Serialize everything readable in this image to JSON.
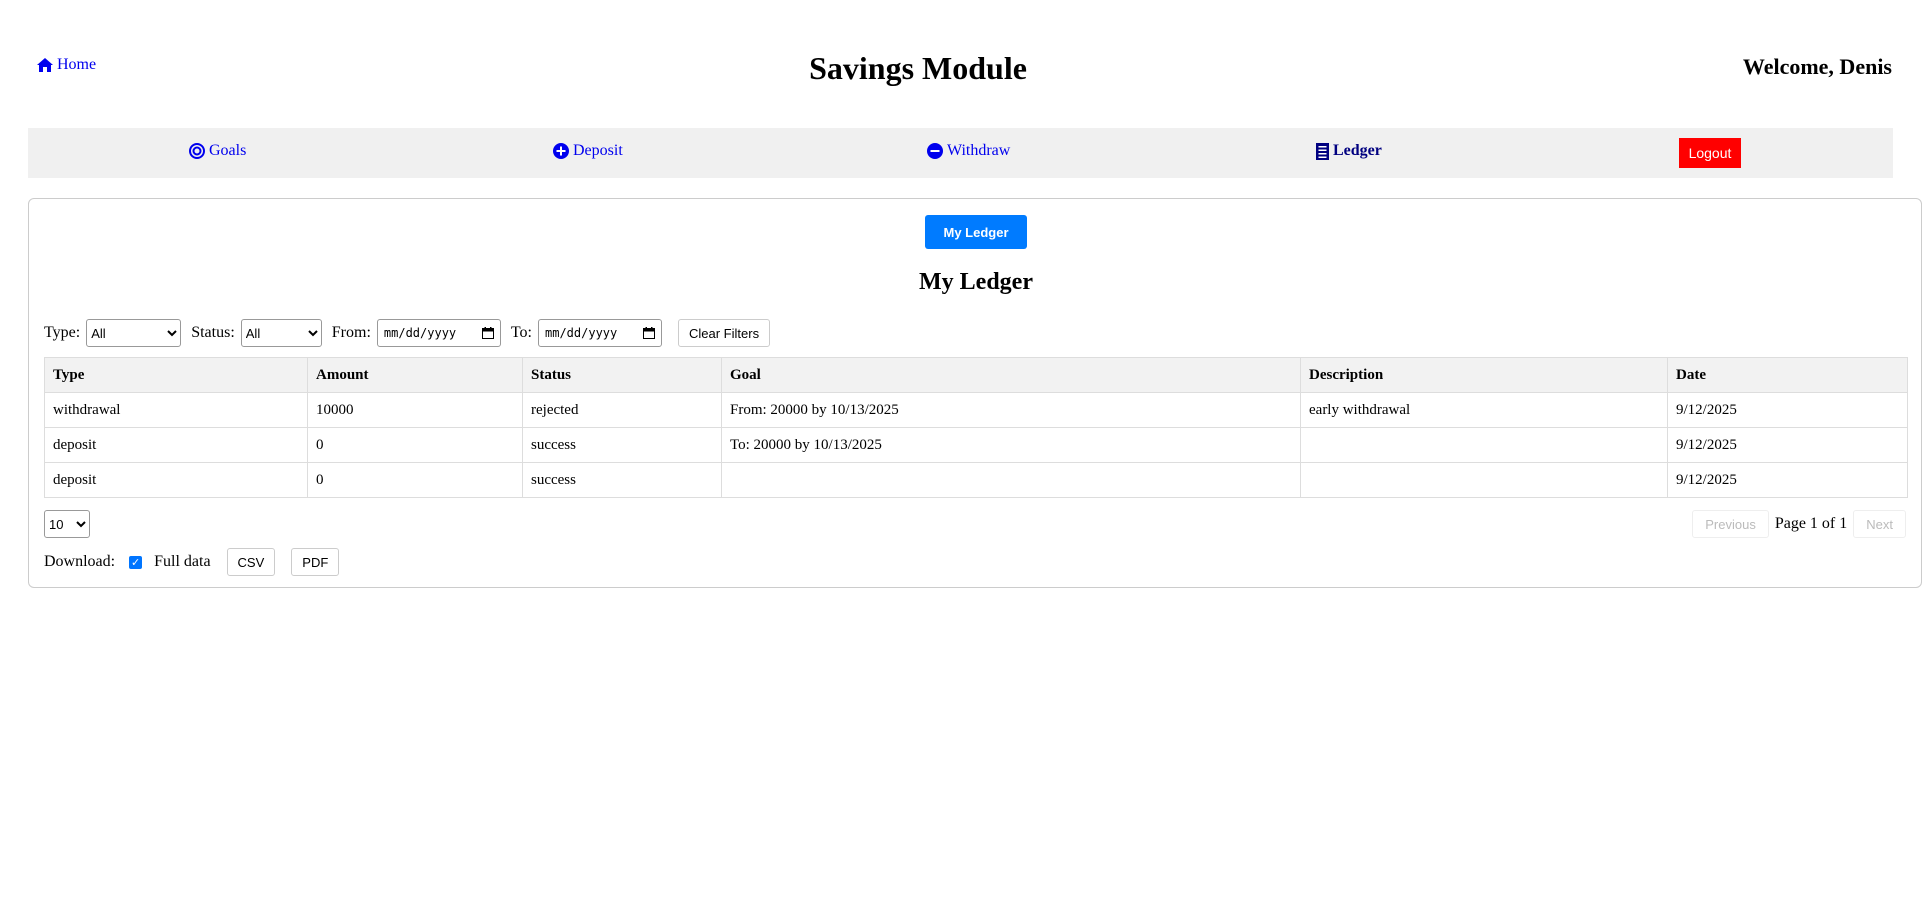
{
  "header": {
    "home_label": "Home",
    "title": "Savings Module",
    "welcome": "Welcome, Denis"
  },
  "nav": {
    "goals": "Goals",
    "deposit": "Deposit",
    "withdraw": "Withdraw",
    "ledger": "Ledger",
    "logout": "Logout"
  },
  "main": {
    "tab_button": "My Ledger",
    "section_title": "My Ledger"
  },
  "filters": {
    "type_label": "Type:",
    "type_value": "All",
    "status_label": "Status:",
    "status_value": "All",
    "from_label": "From:",
    "from_placeholder": "mm/dd/yyyy",
    "to_label": "To:",
    "to_placeholder": "mm/dd/yyyy",
    "clear_label": "Clear Filters"
  },
  "table": {
    "headers": [
      "Type",
      "Amount",
      "Status",
      "Goal",
      "Description",
      "Date"
    ],
    "rows": [
      [
        "withdrawal",
        "10000",
        "rejected",
        "From: 20000 by 10/13/2025",
        "early withdrawal",
        "9/12/2025"
      ],
      [
        "deposit",
        "0",
        "success",
        "To: 20000 by 10/13/2025",
        "",
        "9/12/2025"
      ],
      [
        "deposit",
        "0",
        "success",
        "",
        "",
        "9/12/2025"
      ]
    ]
  },
  "pagination": {
    "page_size": "10",
    "previous": "Previous",
    "page_info": "Page 1 of 1",
    "next": "Next"
  },
  "download": {
    "label": "Download:",
    "full_data_label": "Full data",
    "full_data_checked": true,
    "csv": "CSV",
    "pdf": "PDF"
  },
  "colors": {
    "link": "#0000ee",
    "logout_bg": "#ff0000",
    "primary": "#007bff",
    "nav_bg": "#f0f0f0"
  }
}
